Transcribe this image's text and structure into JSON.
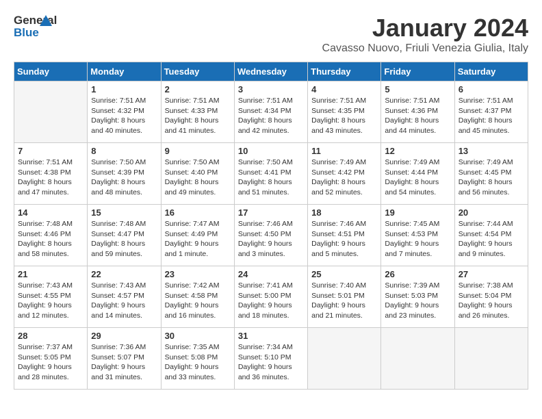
{
  "logo": {
    "general": "General",
    "blue": "Blue"
  },
  "title": "January 2024",
  "location": "Cavasso Nuovo, Friuli Venezia Giulia, Italy",
  "days_of_week": [
    "Sunday",
    "Monday",
    "Tuesday",
    "Wednesday",
    "Thursday",
    "Friday",
    "Saturday"
  ],
  "weeks": [
    [
      {
        "day": "",
        "empty": true
      },
      {
        "day": "1",
        "sunrise": "7:51 AM",
        "sunset": "4:32 PM",
        "daylight": "8 hours and 40 minutes."
      },
      {
        "day": "2",
        "sunrise": "7:51 AM",
        "sunset": "4:33 PM",
        "daylight": "8 hours and 41 minutes."
      },
      {
        "day": "3",
        "sunrise": "7:51 AM",
        "sunset": "4:34 PM",
        "daylight": "8 hours and 42 minutes."
      },
      {
        "day": "4",
        "sunrise": "7:51 AM",
        "sunset": "4:35 PM",
        "daylight": "8 hours and 43 minutes."
      },
      {
        "day": "5",
        "sunrise": "7:51 AM",
        "sunset": "4:36 PM",
        "daylight": "8 hours and 44 minutes."
      },
      {
        "day": "6",
        "sunrise": "7:51 AM",
        "sunset": "4:37 PM",
        "daylight": "8 hours and 45 minutes."
      }
    ],
    [
      {
        "day": "7",
        "sunrise": "7:51 AM",
        "sunset": "4:38 PM",
        "daylight": "8 hours and 47 minutes."
      },
      {
        "day": "8",
        "sunrise": "7:50 AM",
        "sunset": "4:39 PM",
        "daylight": "8 hours and 48 minutes."
      },
      {
        "day": "9",
        "sunrise": "7:50 AM",
        "sunset": "4:40 PM",
        "daylight": "8 hours and 49 minutes."
      },
      {
        "day": "10",
        "sunrise": "7:50 AM",
        "sunset": "4:41 PM",
        "daylight": "8 hours and 51 minutes."
      },
      {
        "day": "11",
        "sunrise": "7:49 AM",
        "sunset": "4:42 PM",
        "daylight": "8 hours and 52 minutes."
      },
      {
        "day": "12",
        "sunrise": "7:49 AM",
        "sunset": "4:44 PM",
        "daylight": "8 hours and 54 minutes."
      },
      {
        "day": "13",
        "sunrise": "7:49 AM",
        "sunset": "4:45 PM",
        "daylight": "8 hours and 56 minutes."
      }
    ],
    [
      {
        "day": "14",
        "sunrise": "7:48 AM",
        "sunset": "4:46 PM",
        "daylight": "8 hours and 58 minutes."
      },
      {
        "day": "15",
        "sunrise": "7:48 AM",
        "sunset": "4:47 PM",
        "daylight": "8 hours and 59 minutes."
      },
      {
        "day": "16",
        "sunrise": "7:47 AM",
        "sunset": "4:49 PM",
        "daylight": "9 hours and 1 minute."
      },
      {
        "day": "17",
        "sunrise": "7:46 AM",
        "sunset": "4:50 PM",
        "daylight": "9 hours and 3 minutes."
      },
      {
        "day": "18",
        "sunrise": "7:46 AM",
        "sunset": "4:51 PM",
        "daylight": "9 hours and 5 minutes."
      },
      {
        "day": "19",
        "sunrise": "7:45 AM",
        "sunset": "4:53 PM",
        "daylight": "9 hours and 7 minutes."
      },
      {
        "day": "20",
        "sunrise": "7:44 AM",
        "sunset": "4:54 PM",
        "daylight": "9 hours and 9 minutes."
      }
    ],
    [
      {
        "day": "21",
        "sunrise": "7:43 AM",
        "sunset": "4:55 PM",
        "daylight": "9 hours and 12 minutes."
      },
      {
        "day": "22",
        "sunrise": "7:43 AM",
        "sunset": "4:57 PM",
        "daylight": "9 hours and 14 minutes."
      },
      {
        "day": "23",
        "sunrise": "7:42 AM",
        "sunset": "4:58 PM",
        "daylight": "9 hours and 16 minutes."
      },
      {
        "day": "24",
        "sunrise": "7:41 AM",
        "sunset": "5:00 PM",
        "daylight": "9 hours and 18 minutes."
      },
      {
        "day": "25",
        "sunrise": "7:40 AM",
        "sunset": "5:01 PM",
        "daylight": "9 hours and 21 minutes."
      },
      {
        "day": "26",
        "sunrise": "7:39 AM",
        "sunset": "5:03 PM",
        "daylight": "9 hours and 23 minutes."
      },
      {
        "day": "27",
        "sunrise": "7:38 AM",
        "sunset": "5:04 PM",
        "daylight": "9 hours and 26 minutes."
      }
    ],
    [
      {
        "day": "28",
        "sunrise": "7:37 AM",
        "sunset": "5:05 PM",
        "daylight": "9 hours and 28 minutes."
      },
      {
        "day": "29",
        "sunrise": "7:36 AM",
        "sunset": "5:07 PM",
        "daylight": "9 hours and 31 minutes."
      },
      {
        "day": "30",
        "sunrise": "7:35 AM",
        "sunset": "5:08 PM",
        "daylight": "9 hours and 33 minutes."
      },
      {
        "day": "31",
        "sunrise": "7:34 AM",
        "sunset": "5:10 PM",
        "daylight": "9 hours and 36 minutes."
      },
      {
        "day": "",
        "empty": true
      },
      {
        "day": "",
        "empty": true
      },
      {
        "day": "",
        "empty": true
      }
    ]
  ],
  "labels": {
    "sunrise": "Sunrise:",
    "sunset": "Sunset:",
    "daylight": "Daylight:"
  }
}
